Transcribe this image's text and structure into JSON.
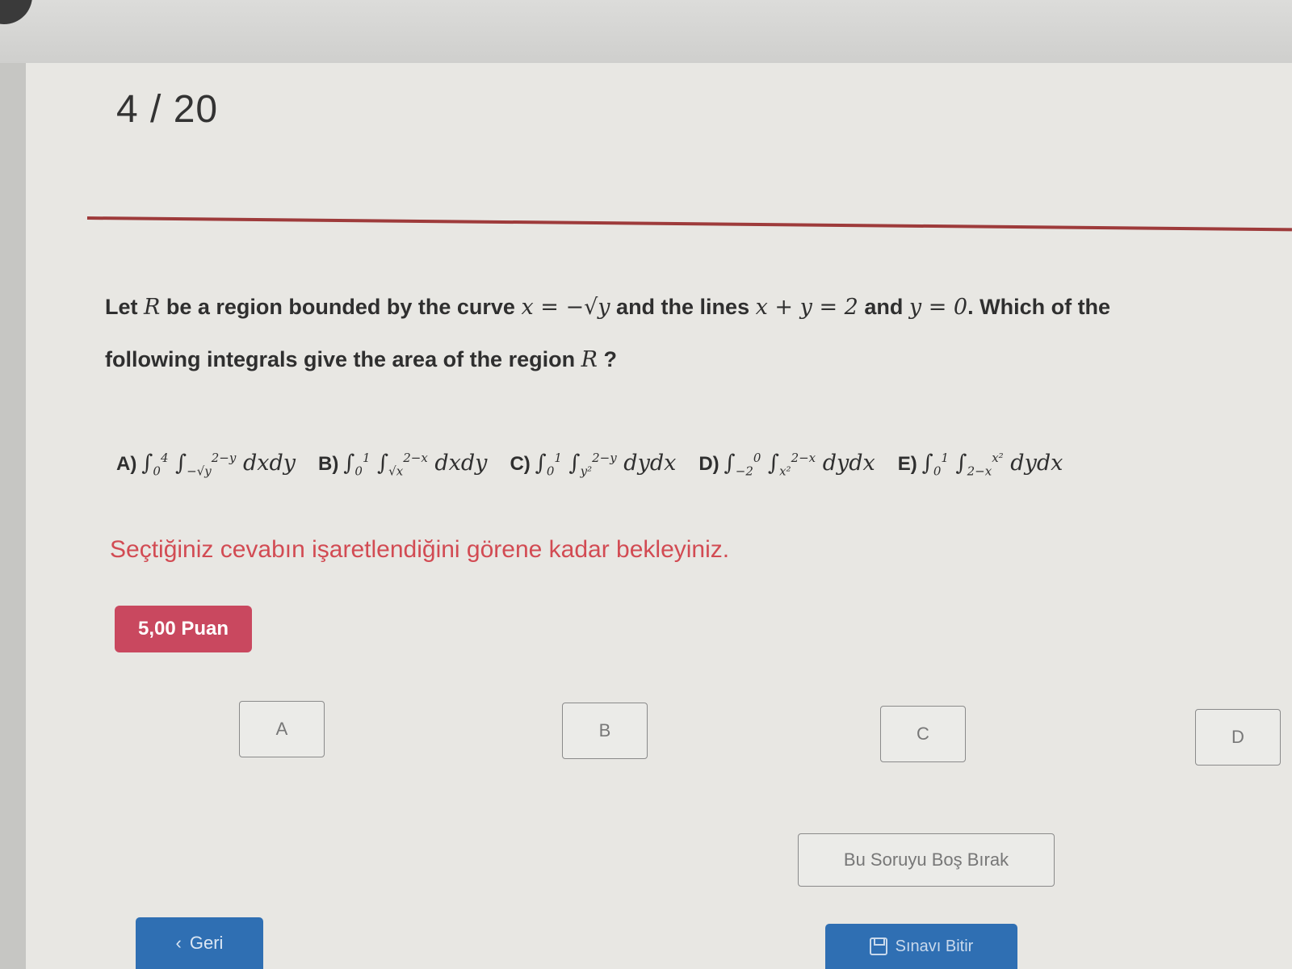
{
  "header": {
    "counter": "4 / 20"
  },
  "question": {
    "part1": "Let ",
    "r1": "R",
    "part2": " be a region bounded by the curve ",
    "curve": "x = −√y",
    "part3": " and the lines ",
    "line1": "x + y = 2",
    "part4": " and ",
    "line2": "y = 0",
    "part5": ". Which of the following integrals give the area of the region ",
    "r2": "R",
    "part6": " ?"
  },
  "options": [
    {
      "label": "A)",
      "outer_lower": "0",
      "outer_upper": "4",
      "inner_lower": "−√y",
      "inner_upper": "2−y",
      "diff": "dxdy"
    },
    {
      "label": "B)",
      "outer_lower": "0",
      "outer_upper": "1",
      "inner_lower": "√x",
      "inner_upper": "2−x",
      "diff": "dxdy"
    },
    {
      "label": "C)",
      "outer_lower": "0",
      "outer_upper": "1",
      "inner_lower": "y²",
      "inner_upper": "2−y",
      "diff": "dydx"
    },
    {
      "label": "D)",
      "outer_lower": "−2",
      "outer_upper": "0",
      "inner_lower": "x²",
      "inner_upper": "2−x",
      "diff": "dydx"
    },
    {
      "label": "E)",
      "outer_lower": "0",
      "outer_upper": "1",
      "inner_lower": "2−x",
      "inner_upper": "x²",
      "diff": "dydx"
    }
  ],
  "warning": "Seçtiğiniz cevabın işaretlendiğini görene kadar bekleyiniz.",
  "points_badge": "5,00 Puan",
  "answers": {
    "a": "A",
    "b": "B",
    "c": "C",
    "d": "D"
  },
  "skip_label": "Bu Soruyu Boş Bırak",
  "back_label": "Geri",
  "finish_label": "Sınavı Bitir",
  "colors": {
    "rule": "#9e3b3b",
    "warning": "#d24b53",
    "badge": "#c9485f",
    "primary_button": "#2f6fb3"
  }
}
